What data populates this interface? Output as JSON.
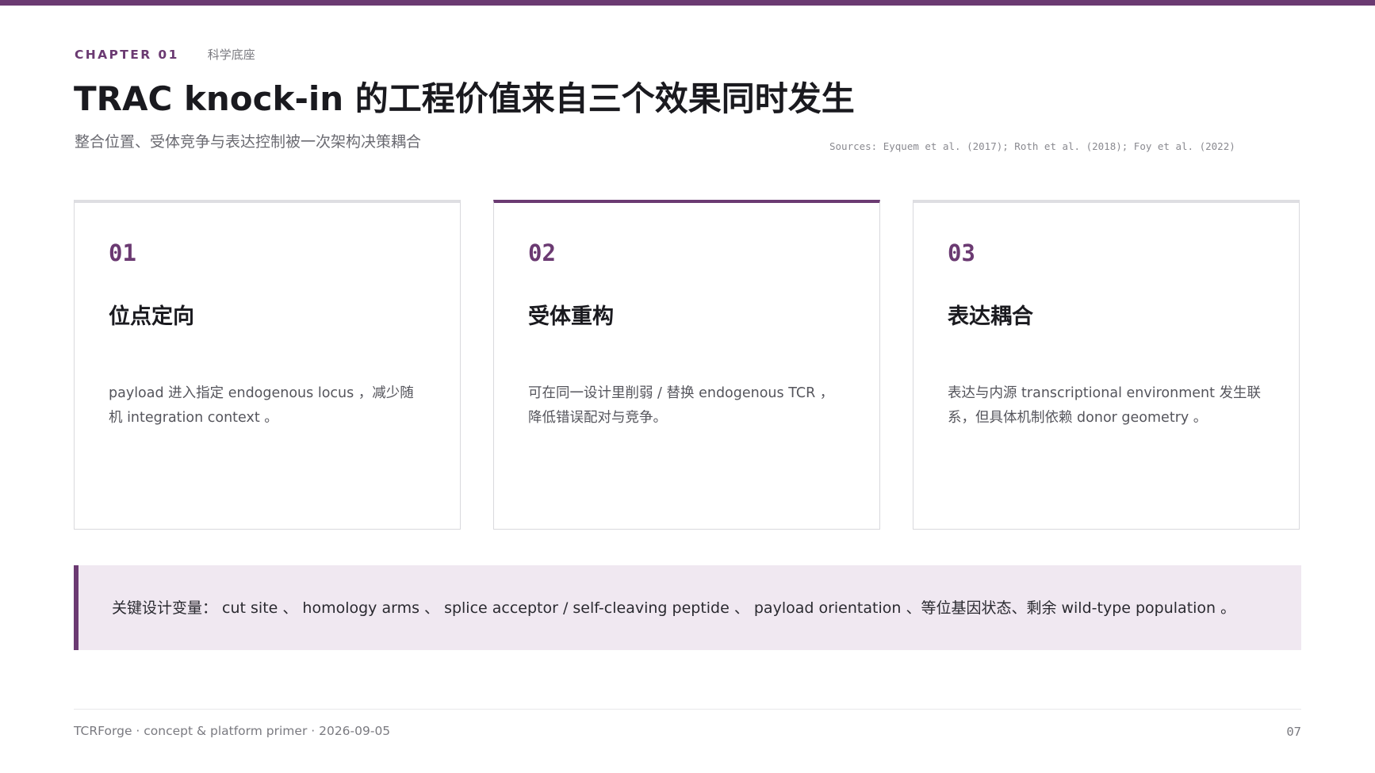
{
  "colors": {
    "accent": "#6b3a72",
    "callout_bg": "#f0e8f1",
    "text_primary": "#1a1a1f",
    "text_muted": "#7a7a80"
  },
  "header": {
    "chapter_label": "CHAPTER 01",
    "chapter_sub": "科学底座",
    "title": "TRAC knock-in  的工程价值来自三个效果同时发生",
    "subtitle": "整合位置、受体竞争与表达控制被一次架构决策耦合",
    "sources": "Sources: Eyquem et al. (2017); Roth et al. (2018); Foy et al. (2022)"
  },
  "cards": [
    {
      "number": "01",
      "title": "位点定向",
      "body": "payload  进入指定  endogenous locus ，减少随机  integration context 。",
      "active": false
    },
    {
      "number": "02",
      "title": "受体重构",
      "body": "可在同一设计里削弱 / 替换  endogenous TCR ，降低错误配对与竞争。",
      "active": true
    },
    {
      "number": "03",
      "title": "表达耦合",
      "body": "表达与内源  transcriptional environment  发生联系，但具体机制依赖  donor geometry 。",
      "active": false
    }
  ],
  "callout": {
    "text": "关键设计变量：  cut site 、 homology arms 、 splice acceptor / self-cleaving peptide 、 payload orientation 、等位基因状态、剩余  wild-type population 。"
  },
  "footer": {
    "left": "TCRForge · concept & platform primer · 2026-09-05",
    "page_number": "07"
  }
}
